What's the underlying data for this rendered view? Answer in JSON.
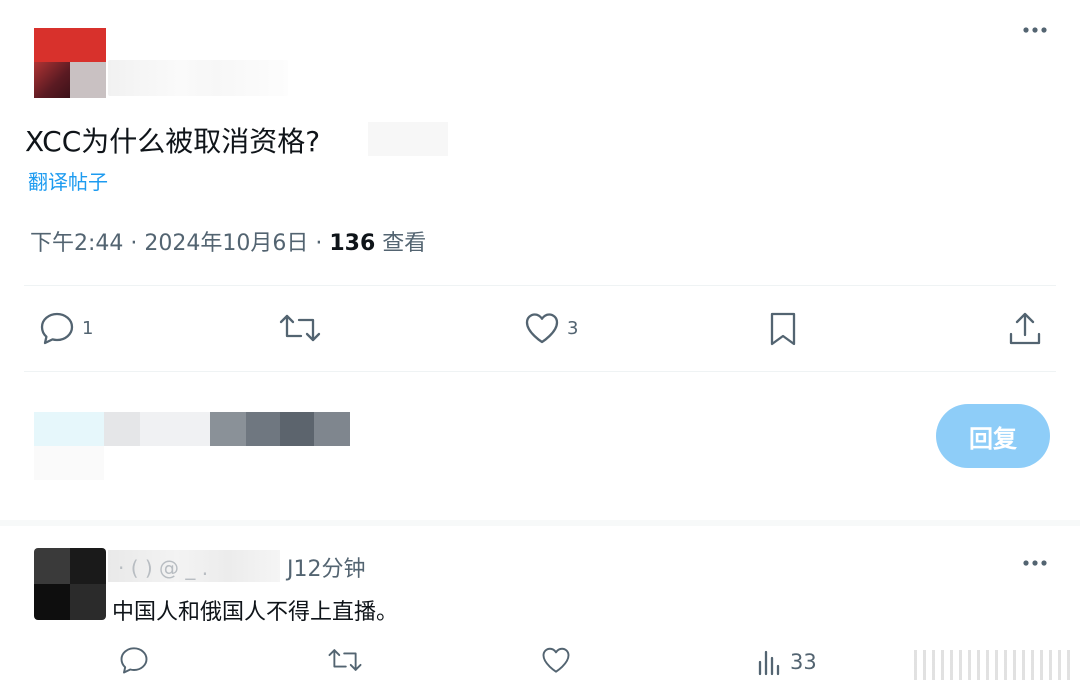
{
  "post": {
    "text": "XCC为什么被取消资格?",
    "translate_label": "翻译帖子",
    "time": "下午2:44 · 2024年10月6日 · ",
    "views_count": "136",
    "views_label": " 查看",
    "more_icon": "more-horizontal-icon",
    "actions": {
      "reply_count": "1",
      "retweet_count": "",
      "like_count": "3"
    }
  },
  "composer": {
    "reply_button_label": "回复"
  },
  "comment": {
    "name_partial": "J12分钟",
    "name_faint": "· ( ) @ _ .",
    "text": "中国人和俄国人不得上直播。",
    "views_count": "33"
  },
  "colors": {
    "accent": "#1d9bf0",
    "reply_button": "#8ecdf8",
    "secondary_text": "#536471",
    "divider": "#eff3f4"
  }
}
